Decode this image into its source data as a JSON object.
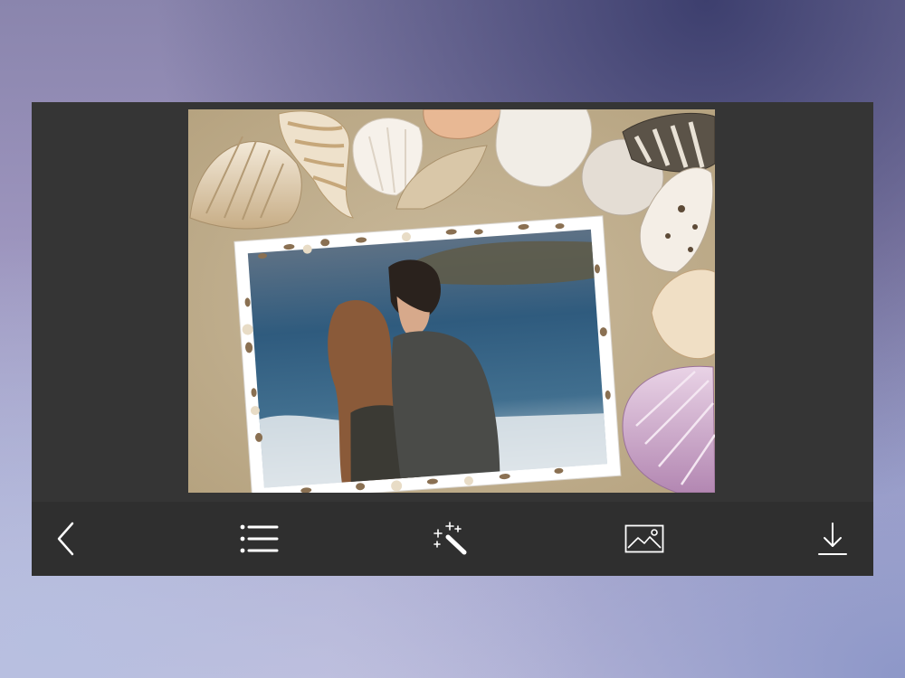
{
  "app": {
    "toolbar": {
      "items": [
        {
          "name": "back",
          "icon": "chevron-left-icon"
        },
        {
          "name": "frames-list",
          "icon": "list-icon"
        },
        {
          "name": "effects",
          "icon": "magic-wand-icon"
        },
        {
          "name": "gallery",
          "icon": "image-icon"
        },
        {
          "name": "save",
          "icon": "download-icon"
        }
      ]
    }
  },
  "colors": {
    "panel": "#353535",
    "toolbar": "#2f2f2f",
    "icon": "#ffffff",
    "sand": "#c2b192",
    "sea": "#2f5b7e"
  }
}
